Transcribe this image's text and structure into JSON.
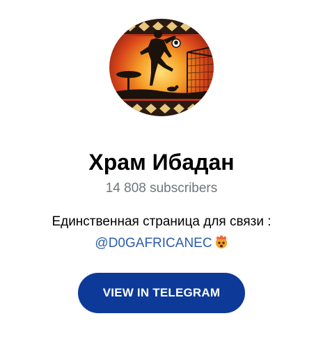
{
  "channel": {
    "title": "Храм Ибадан",
    "subscribers": "14 808 subscribers",
    "description_line1": "Единственная страница для связи :",
    "description_link": "@D0GAFRICANEC",
    "emoji_icon": "exploding-head-emoji-icon"
  },
  "avatar": {
    "icon": "footballer-silhouette-sunset-avatar"
  },
  "actions": {
    "view_label": "VIEW IN TELEGRAM"
  },
  "colors": {
    "button": "#0D3A98",
    "link": "#2A5CAB",
    "subtitle": "#707579",
    "title": "#000000"
  }
}
